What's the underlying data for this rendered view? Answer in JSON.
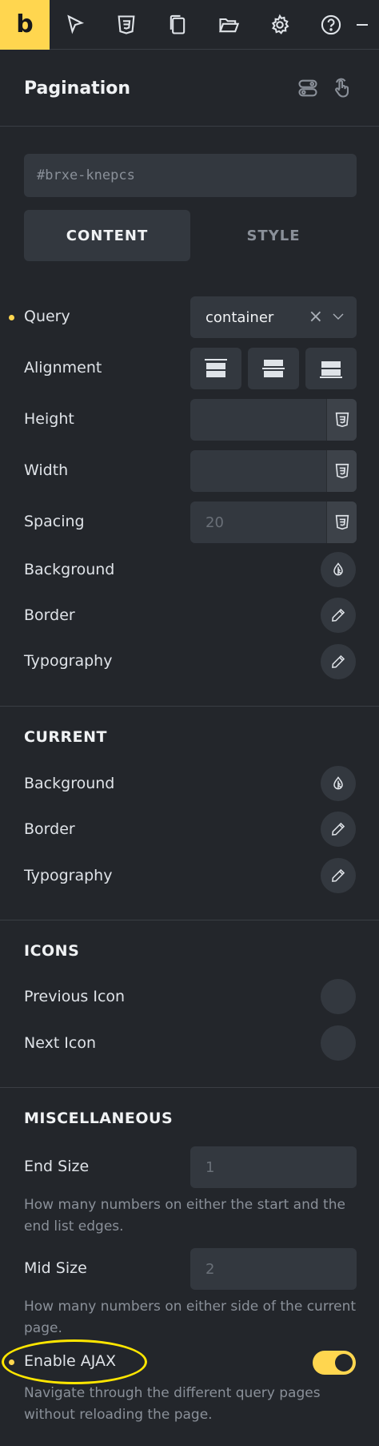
{
  "toolbar": {
    "logo": "b",
    "icons": [
      "cursor-icon",
      "css3-icon",
      "pages-icon",
      "folder-icon",
      "gear-icon",
      "help-icon"
    ]
  },
  "panel": {
    "title": "Pagination",
    "element_id": "#brxe-knepcs",
    "tabs": [
      {
        "label": "CONTENT",
        "active": true
      },
      {
        "label": "STYLE",
        "active": false
      }
    ]
  },
  "content": {
    "query": {
      "label": "Query",
      "value": "container",
      "clear": "×"
    },
    "alignment": {
      "label": "Alignment"
    },
    "height": {
      "label": "Height",
      "value": ""
    },
    "width": {
      "label": "Width",
      "value": ""
    },
    "spacing": {
      "label": "Spacing",
      "placeholder": "20"
    },
    "background": {
      "label": "Background"
    },
    "border": {
      "label": "Border"
    },
    "typography": {
      "label": "Typography"
    }
  },
  "current": {
    "title": "CURRENT",
    "background": {
      "label": "Background"
    },
    "border": {
      "label": "Border"
    },
    "typography": {
      "label": "Typography"
    }
  },
  "icons_section": {
    "title": "ICONS",
    "previous": {
      "label": "Previous Icon"
    },
    "next": {
      "label": "Next Icon"
    }
  },
  "misc": {
    "title": "MISCELLANEOUS",
    "end_size": {
      "label": "End Size",
      "placeholder": "1",
      "description": "How many numbers on either the start and the end list edges."
    },
    "mid_size": {
      "label": "Mid Size",
      "placeholder": "2",
      "description": "How many numbers on either side of the current page."
    },
    "ajax": {
      "label": "Enable AJAX",
      "enabled": true,
      "description": "Navigate through the different query pages without reloading the page."
    }
  },
  "colors": {
    "accent": "#ffd64f",
    "background": "#23262b",
    "field": "#33383f",
    "highlight": "#ffe600"
  }
}
